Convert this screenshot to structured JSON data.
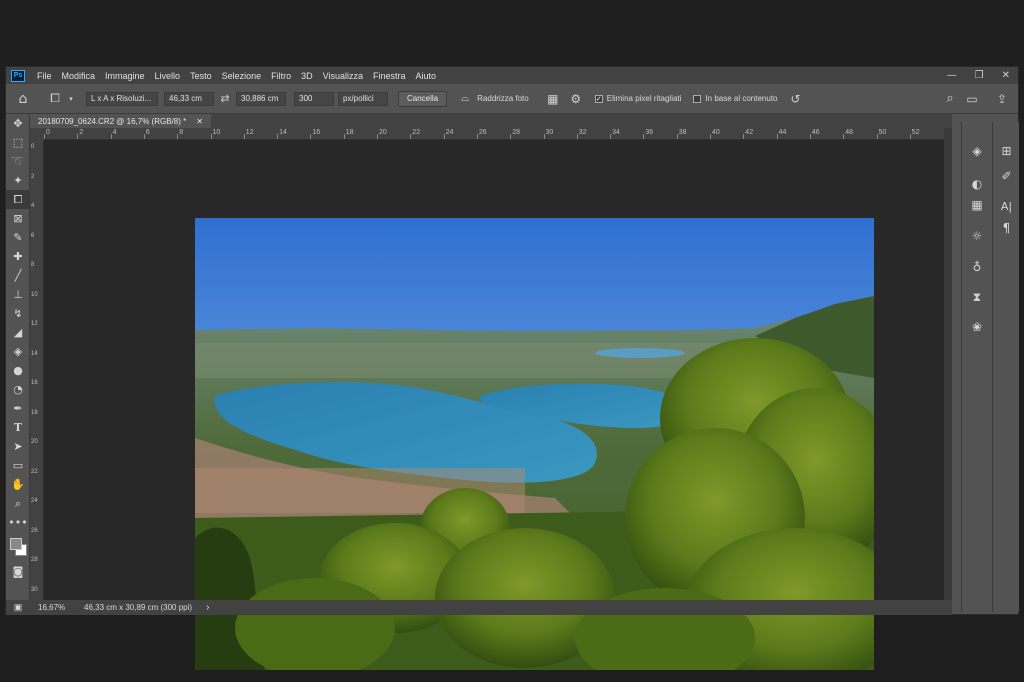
{
  "menu": [
    "File",
    "Modifica",
    "Immagine",
    "Livello",
    "Testo",
    "Selezione",
    "Filtro",
    "3D",
    "Visualizza",
    "Finestra",
    "Aiuto"
  ],
  "app_logo": "Ps",
  "window_controls": {
    "minimize": "—",
    "restore": "❐",
    "close": "✕"
  },
  "options": {
    "ratio_preset": "L x A x Risoluzi...",
    "width": "46,33 cm",
    "height": "30,886 cm",
    "resolution": "300",
    "resolution_unit": "px/pollici",
    "clear_label": "Cancella",
    "straighten_label": "Raddrizza foto",
    "delete_cropped_label": "Elimina pixel ritagliati",
    "delete_cropped_checked": "✓",
    "content_aware_label": "In base al contenuto"
  },
  "document_tab": {
    "title": "20180709_0624.CR2 @ 16,7% (RGB/8) *",
    "close": "✕"
  },
  "ruler_top_labels": [
    "0",
    "2",
    "4",
    "6",
    "8",
    "10",
    "12",
    "14",
    "16",
    "18",
    "20",
    "22",
    "24",
    "26",
    "28",
    "30",
    "32",
    "34",
    "36",
    "38",
    "40",
    "42",
    "44",
    "46",
    "48",
    "50",
    "52"
  ],
  "ruler_left_labels": [
    "0",
    "2",
    "4",
    "6",
    "8",
    "10",
    "12",
    "14",
    "16",
    "18",
    "20",
    "22",
    "24",
    "26",
    "28",
    "30"
  ],
  "status": {
    "zoom": "16,67%",
    "doc_info": "46,33 cm x 30,89 cm (300 ppi)",
    "arrow": "›"
  },
  "icons": {
    "home": "⌂",
    "crop": "⧠",
    "swap": "⇄",
    "grid": "▦",
    "gear": "⚙",
    "reset": "↺",
    "search": "⌕",
    "workspace": "▭",
    "share": "⇪"
  },
  "colors": {
    "sky_top": "#2f6fd0",
    "sky_bottom": "#a8c8ec",
    "lake": "#2a87b6",
    "forest": "#4a6a16"
  }
}
